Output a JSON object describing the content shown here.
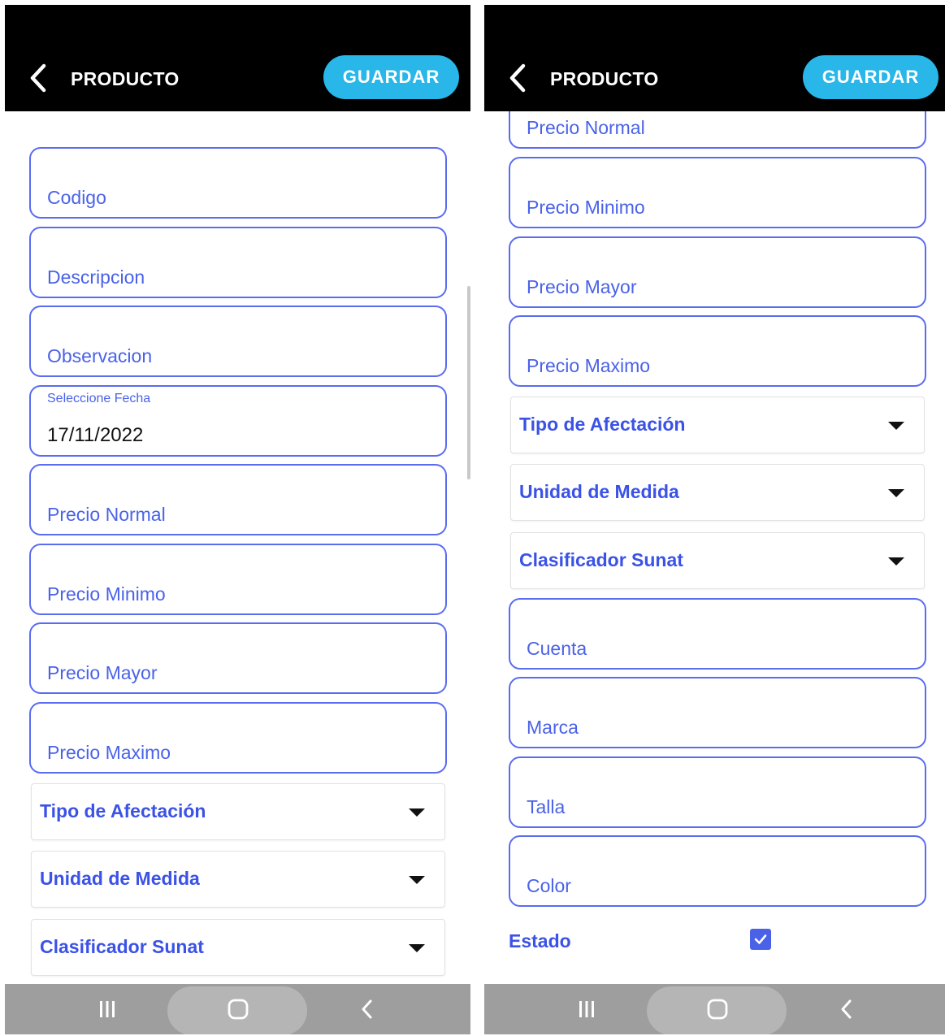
{
  "screens": [
    {
      "header": {
        "title": "PRODUCTO",
        "save_label": "GUARDAR"
      },
      "form": {
        "codigo": "Codigo",
        "descripcion": "Descripcion",
        "observacion": "Observacion",
        "fecha_label": "Seleccione Fecha",
        "fecha_value": "17/11/2022",
        "precio_normal": "Precio Normal",
        "precio_minimo": "Precio Minimo",
        "precio_mayor": "Precio Mayor",
        "precio_maximo": "Precio Maximo",
        "tipo_afectacion": "Tipo de Afectación",
        "unidad_medida": "Unidad de Medida",
        "clasificador_sunat": "Clasificador Sunat"
      }
    },
    {
      "header": {
        "title": "PRODUCTO",
        "save_label": "GUARDAR"
      },
      "form": {
        "precio_normal": "Precio Normal",
        "precio_minimo": "Precio Minimo",
        "precio_mayor": "Precio Mayor",
        "precio_maximo": "Precio Maximo",
        "tipo_afectacion": "Tipo de Afectación",
        "unidad_medida": "Unidad de Medida",
        "clasificador_sunat": "Clasificador Sunat",
        "cuenta": "Cuenta",
        "marca": "Marca",
        "talla": "Talla",
        "color": "Color",
        "estado_label": "Estado",
        "estado_checked": true
      }
    }
  ],
  "colors": {
    "accent": "#4a62e8",
    "field_border": "#5a6cf0",
    "button": "#29b6e8",
    "header_bg": "#000000",
    "navbar_bg": "#9e9e9e"
  },
  "icons": [
    "back-arrow-icon",
    "dropdown-caret-icon",
    "checkbox-checked-icon",
    "recents-icon",
    "home-icon",
    "nav-back-icon"
  ]
}
